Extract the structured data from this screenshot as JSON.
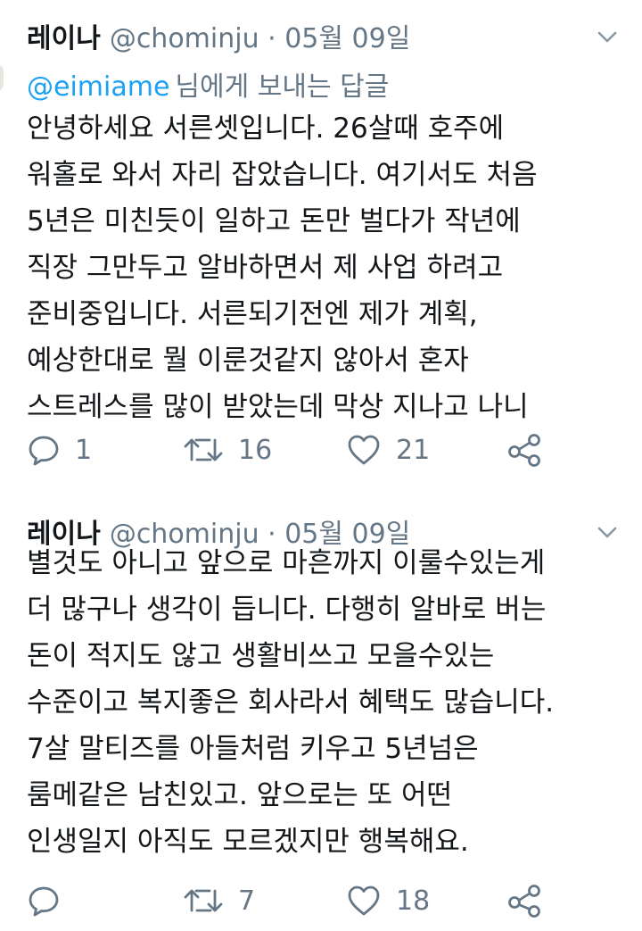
{
  "tweets": [
    {
      "name": "레이나",
      "handle": "@chominju · 05월 09일",
      "reply_to": {
        "mention": "@eimiame",
        "label": "님에게 보내는 답글"
      },
      "lines": [
        "안녕하세요 서른셋입니다. 26살때 호주에",
        "워홀로 와서 자리 잡았습니다. 여기서도 처음",
        "5년은 미친듯이 일하고 돈만 벌다가 작년에",
        "직장 그만두고 알바하면서 제 사업 하려고",
        "준비중입니다. 서른되기전엔 제가 계획,",
        "예상한대로 뭘 이룬것같지 않아서 혼자",
        "스트레스를 많이 받았는데 막상 지나고 나니"
      ],
      "counts": {
        "reply": "1",
        "retweet": "16",
        "like": "21"
      }
    },
    {
      "name": "레이나",
      "handle": "@chominju · 05월 09일",
      "lines": [
        "별것도 아니고 앞으로 마흔까지 이룰수있는게",
        "더 많구나 생각이 듭니다. 다행히 알바로 버는",
        "돈이 적지도 않고 생활비쓰고 모을수있는",
        "수준이고 복지좋은 회사라서 혜택도 많습니다.",
        "7살 말티즈를 아들처럼 키우고 5년넘은",
        "룸메같은 남친있고. 앞으로는 또 어떤",
        "인생일지 아직도 모르겠지만 행복해요."
      ],
      "counts": {
        "reply": "",
        "retweet": "7",
        "like": "18"
      }
    }
  ],
  "colors": {
    "text": "#14171a",
    "secondary": "#657786",
    "link": "#1da1f2"
  },
  "icons": [
    "reply-icon",
    "retweet-icon",
    "like-icon",
    "share-icon",
    "chevron-down-icon"
  ]
}
